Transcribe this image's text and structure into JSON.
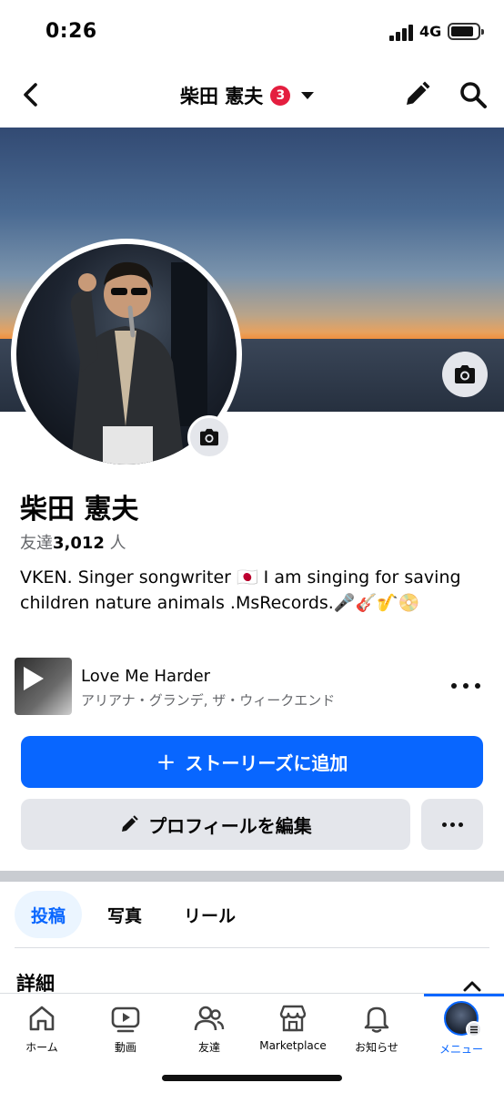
{
  "status_bar": {
    "time": "0:26",
    "network": "4G"
  },
  "header": {
    "title": "柴田 憲夫",
    "badge_count": "3"
  },
  "profile": {
    "name": "柴田 憲夫",
    "friends_prefix": "友達",
    "friends_count": "3,012",
    "friends_suffix": "人",
    "bio_text": "VKEN. Singer songwriter 🇯🇵 I am singing for saving children nature animals .MsRecords.🎤🎸🎷📀"
  },
  "music": {
    "song_title": "Love Me Harder",
    "artist": "アリアナ・グランデ, ザ・ウィークエンド"
  },
  "buttons": {
    "add_story_icon": "+",
    "add_story_label": "ストーリーズに追加",
    "edit_profile_label": "プロフィールを編集"
  },
  "tabs": [
    {
      "label": "投稿"
    },
    {
      "label": "写真"
    },
    {
      "label": "リール"
    }
  ],
  "section_title": "詳細",
  "bottom_nav": [
    {
      "label": "ホーム",
      "icon": "home-icon"
    },
    {
      "label": "動画",
      "icon": "video-icon"
    },
    {
      "label": "友達",
      "icon": "friends-icon"
    },
    {
      "label": "Marketplace",
      "icon": "marketplace-icon"
    },
    {
      "label": "お知らせ",
      "icon": "bell-icon"
    },
    {
      "label": "メニュー",
      "icon": "menu-avatar-icon"
    }
  ],
  "colors": {
    "accent": "#0866ff",
    "badge": "#e41e3f",
    "secondary_button": "#e4e6eb",
    "muted_text": "#65676b"
  }
}
